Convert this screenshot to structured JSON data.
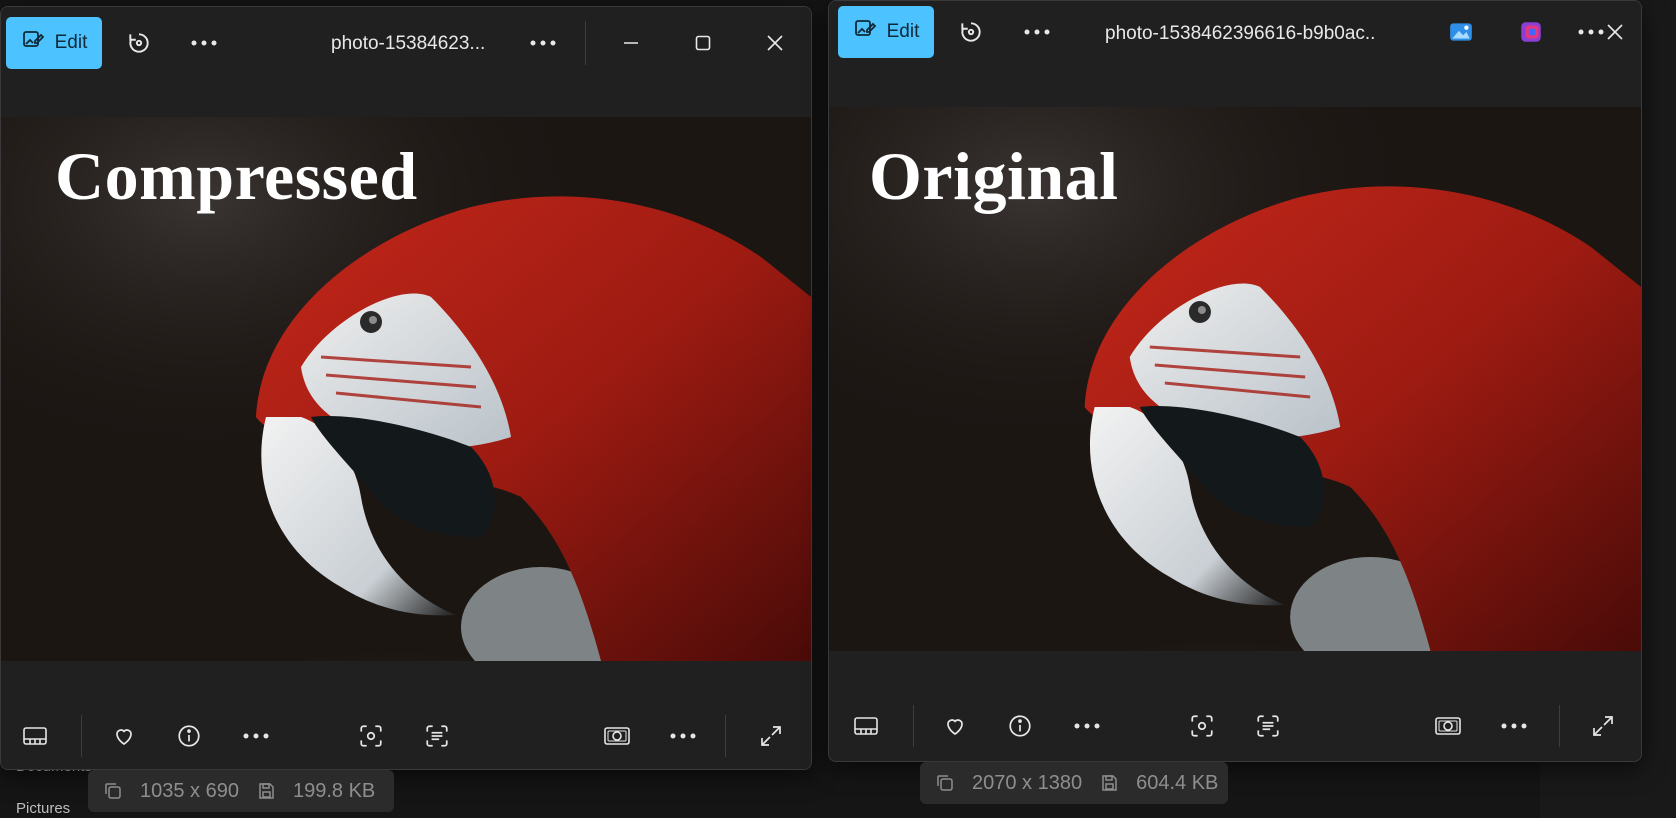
{
  "windows": [
    {
      "id": "compressed",
      "edit_label": "Edit",
      "title": "photo-15384623...",
      "overlay_label": "Compressed",
      "dimensions": "1035 x 690",
      "file_size": "199.8 KB"
    },
    {
      "id": "original",
      "edit_label": "Edit",
      "title": "photo-1538462396616-b9b0ac...",
      "overlay_label": "Original",
      "dimensions": "2070 x 1380",
      "file_size": "604.4 KB"
    }
  ],
  "background": {
    "sidebar_item_documents": "Documents",
    "sidebar_item_pictures": "Pictures"
  },
  "colors": {
    "accent": "#4cc2ff",
    "window_bg": "#202020",
    "desktop_bg": "#151515"
  },
  "icons": {
    "edit": "edit-image-icon",
    "rotate": "rotate-icon",
    "more": "more-horizontal-icon",
    "minimize": "minimize-icon",
    "maximize": "maximize-icon",
    "close": "close-icon",
    "filmstrip": "filmstrip-icon",
    "favorite": "heart-icon",
    "info": "info-icon",
    "visual_search": "visual-search-icon",
    "text_scan": "text-scan-icon",
    "slideshow": "slideshow-icon",
    "fullscreen": "fullscreen-icon"
  }
}
